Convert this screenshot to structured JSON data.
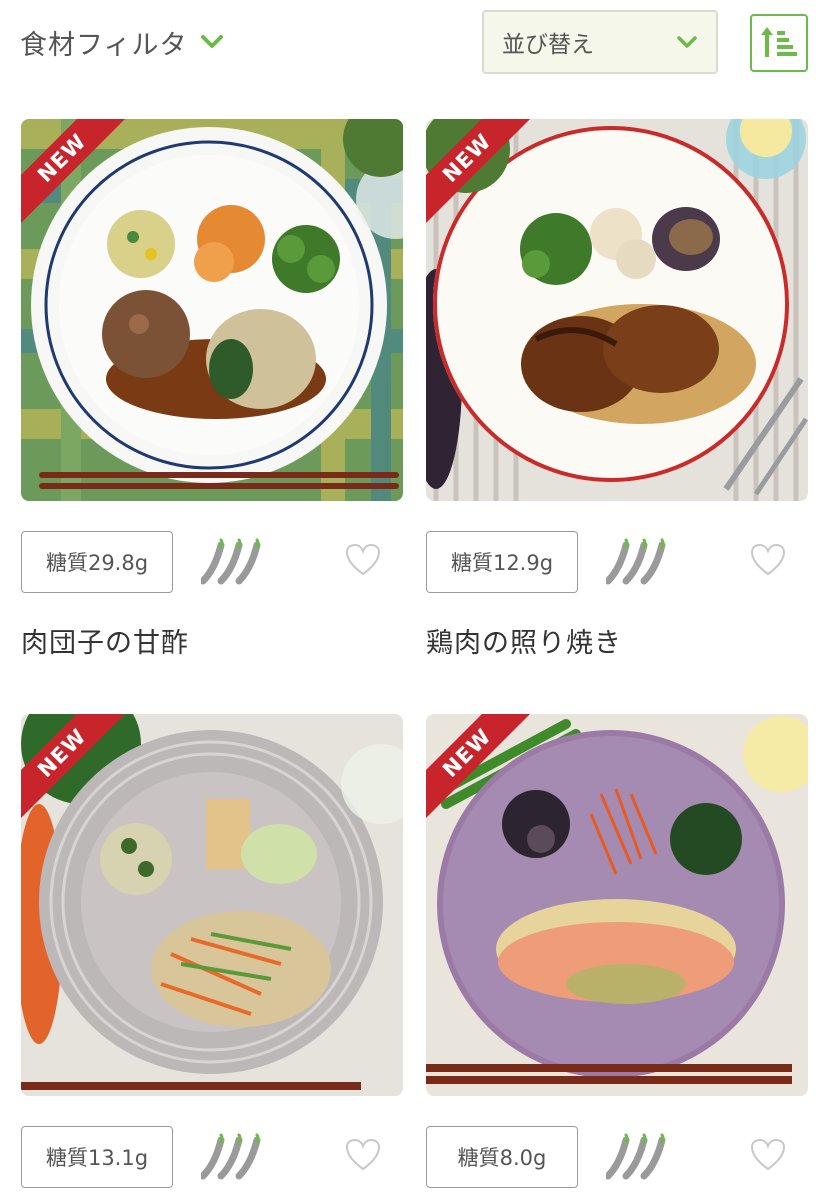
{
  "toolbar": {
    "filter_label": "食材フィルタ",
    "filter_icon": "chevron-down-icon",
    "sort_label": "並び替え",
    "sort_icon": "chevron-down-icon",
    "order_icon": "sort-ascending-icon",
    "accent_color": "#6cbb47"
  },
  "cards": [
    {
      "badge": "NEW",
      "carb_label": "糖質29.8g",
      "spice_icon": "chili-pepper-icon",
      "favorite_icon": "heart-icon",
      "title": "肉団子の甘酢"
    },
    {
      "badge": "NEW",
      "carb_label": "糖質12.9g",
      "spice_icon": "chili-pepper-icon",
      "favorite_icon": "heart-icon",
      "title": "鶏肉の照り焼き"
    },
    {
      "badge": "NEW",
      "carb_label": "糖質13.1g",
      "spice_icon": "chili-pepper-icon",
      "favorite_icon": "heart-icon",
      "title": ""
    },
    {
      "badge": "NEW",
      "carb_label": "糖質8.0g",
      "spice_icon": "chili-pepper-icon",
      "favorite_icon": "heart-icon",
      "title": ""
    }
  ],
  "colors": {
    "ribbon": "#c8242b",
    "border": "#9a9a9a"
  }
}
